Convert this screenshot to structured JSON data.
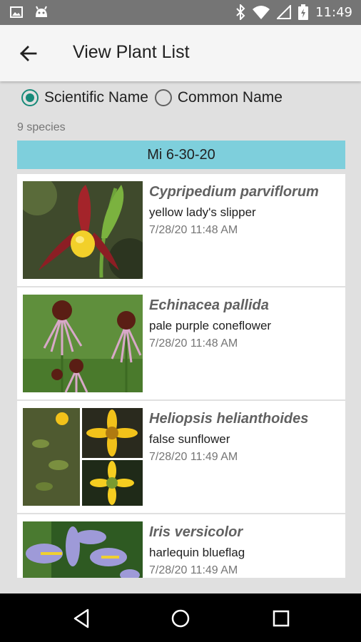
{
  "status_bar": {
    "time": "11:49",
    "left_icons": [
      "image-icon",
      "android-icon"
    ],
    "right_icons": [
      "bluetooth-icon",
      "wifi-icon",
      "signal-icon",
      "battery-icon"
    ]
  },
  "app_bar": {
    "title": "View Plant List",
    "back_icon": "arrow-back-icon"
  },
  "name_toggle": {
    "options": [
      {
        "label": "Scientific Name",
        "checked": true
      },
      {
        "label": "Common Name",
        "checked": false
      }
    ],
    "accent_color": "#178a79"
  },
  "species_count": "9 species",
  "group": {
    "title": "Mi 6-30-20",
    "color": "#7ecfdc"
  },
  "plants": [
    {
      "scientific": "Cypripedium parviflorum",
      "common": "yellow lady's slipper",
      "timestamp": "7/28/20 11:48 AM"
    },
    {
      "scientific": "Echinacea pallida",
      "common": "pale purple coneflower",
      "timestamp": "7/28/20 11:48 AM"
    },
    {
      "scientific": "Heliopsis helianthoides",
      "common": "false sunflower",
      "timestamp": "7/28/20 11:49 AM"
    },
    {
      "scientific": "Iris versicolor",
      "common": "harlequin blueflag",
      "timestamp": "7/28/20 11:49 AM"
    }
  ],
  "nav_bar": {
    "buttons": [
      "back-triangle-icon",
      "home-circle-icon",
      "recents-square-icon"
    ]
  }
}
